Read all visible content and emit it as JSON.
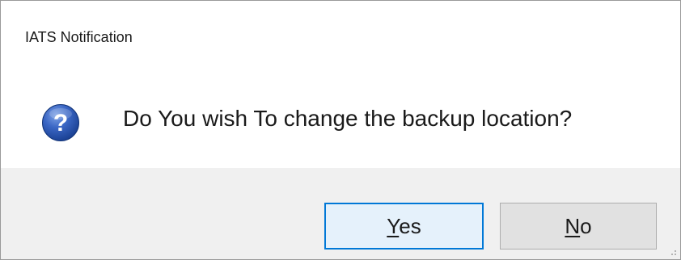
{
  "window": {
    "title": "IATS Notification"
  },
  "dialog": {
    "icon": "question-icon",
    "message": "Do You wish To change the backup location?",
    "accent_color": "#0078d7",
    "icon_color": "#1f4fa8"
  },
  "buttons": {
    "yes": {
      "mnemonic": "Y",
      "rest": "es"
    },
    "no": {
      "mnemonic": "N",
      "rest": "o"
    }
  }
}
